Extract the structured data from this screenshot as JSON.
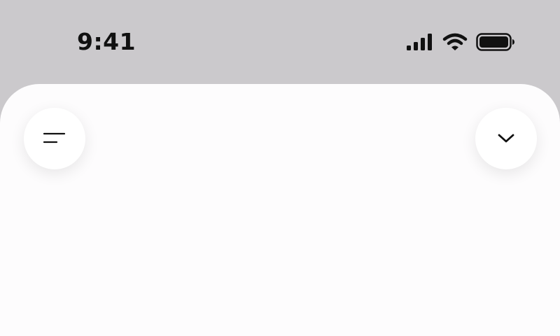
{
  "status_bar": {
    "time": "9:41",
    "icons": [
      "cellular-signal-icon",
      "wifi-icon",
      "battery-icon"
    ]
  },
  "toolbar": {
    "left_button_icon": "menu-lines-icon",
    "right_button_icon": "chevron-down-icon"
  },
  "colors": {
    "background": "#cbc9cc",
    "sheet": "#fdfcfd",
    "button": "#ffffff",
    "foreground": "#111111"
  }
}
